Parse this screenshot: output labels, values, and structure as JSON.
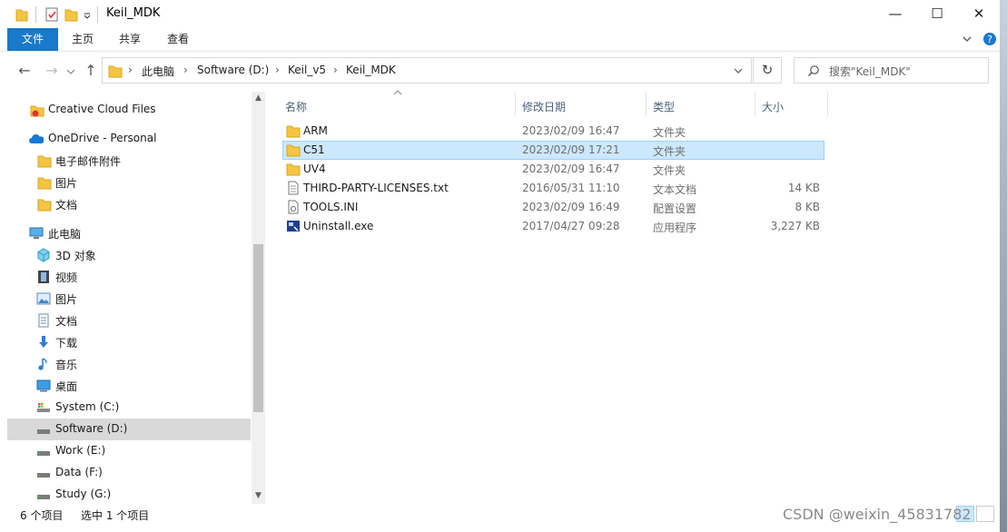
{
  "window": {
    "title": "Keil_MDK",
    "controls": {
      "minimize": "—",
      "maximize": "☐",
      "close": "✕"
    }
  },
  "ribbon": {
    "tabs": [
      "文件",
      "主页",
      "共享",
      "查看"
    ],
    "expand_icon": "chevron-down-icon",
    "help_icon": "help-icon"
  },
  "address": {
    "breadcrumbs": [
      "此电脑",
      "Software (D:)",
      "Keil_v5",
      "Keil_MDK"
    ],
    "search_placeholder": "搜索\"Keil_MDK\""
  },
  "nav": {
    "items": [
      {
        "label": "Creative Cloud Files",
        "icon": "creative-cloud-icon"
      },
      {
        "label": "OneDrive - Personal",
        "icon": "onedrive-icon"
      },
      {
        "label": "电子邮件附件",
        "icon": "folder-icon"
      },
      {
        "label": "图片",
        "icon": "folder-icon"
      },
      {
        "label": "文档",
        "icon": "folder-icon"
      },
      {
        "label": "此电脑",
        "icon": "computer-icon"
      },
      {
        "label": "3D 对象",
        "icon": "3d-objects-icon"
      },
      {
        "label": "视频",
        "icon": "video-icon"
      },
      {
        "label": "图片",
        "icon": "pictures-icon"
      },
      {
        "label": "文档",
        "icon": "documents-icon"
      },
      {
        "label": "下载",
        "icon": "download-icon"
      },
      {
        "label": "音乐",
        "icon": "music-icon"
      },
      {
        "label": "桌面",
        "icon": "desktop-icon"
      },
      {
        "label": "System (C:)",
        "icon": "system-drive-icon"
      },
      {
        "label": "Software (D:)",
        "icon": "drive-icon",
        "selected": true
      },
      {
        "label": "Work (E:)",
        "icon": "drive-icon"
      },
      {
        "label": "Data (F:)",
        "icon": "drive-icon"
      },
      {
        "label": "Study (G:)",
        "icon": "drive-icon"
      }
    ]
  },
  "columns": {
    "name": "名称",
    "date": "修改日期",
    "type": "类型",
    "size": "大小"
  },
  "files": [
    {
      "name": "ARM",
      "date": "2023/02/09 16:47",
      "type": "文件夹",
      "size": "",
      "icon": "folder-icon"
    },
    {
      "name": "C51",
      "date": "2023/02/09 17:21",
      "type": "文件夹",
      "size": "",
      "icon": "folder-icon",
      "selected": true
    },
    {
      "name": "UV4",
      "date": "2023/02/09 16:47",
      "type": "文件夹",
      "size": "",
      "icon": "folder-icon"
    },
    {
      "name": "THIRD-PARTY-LICENSES.txt",
      "date": "2016/05/31 11:10",
      "type": "文本文档",
      "size": "14 KB",
      "icon": "text-file-icon"
    },
    {
      "name": "TOOLS.INI",
      "date": "2023/02/09 16:49",
      "type": "配置设置",
      "size": "8 KB",
      "icon": "ini-file-icon"
    },
    {
      "name": "Uninstall.exe",
      "date": "2017/04/27 09:28",
      "type": "应用程序",
      "size": "3,227 KB",
      "icon": "exe-file-icon"
    }
  ],
  "status": {
    "item_count": "6 个项目",
    "selection": "选中 1 个项目"
  },
  "watermark": "CSDN @weixin_45831782",
  "colors": {
    "accent": "#1979ca",
    "selection": "#cce8ff",
    "nav_selected": "#d9d9d9"
  }
}
